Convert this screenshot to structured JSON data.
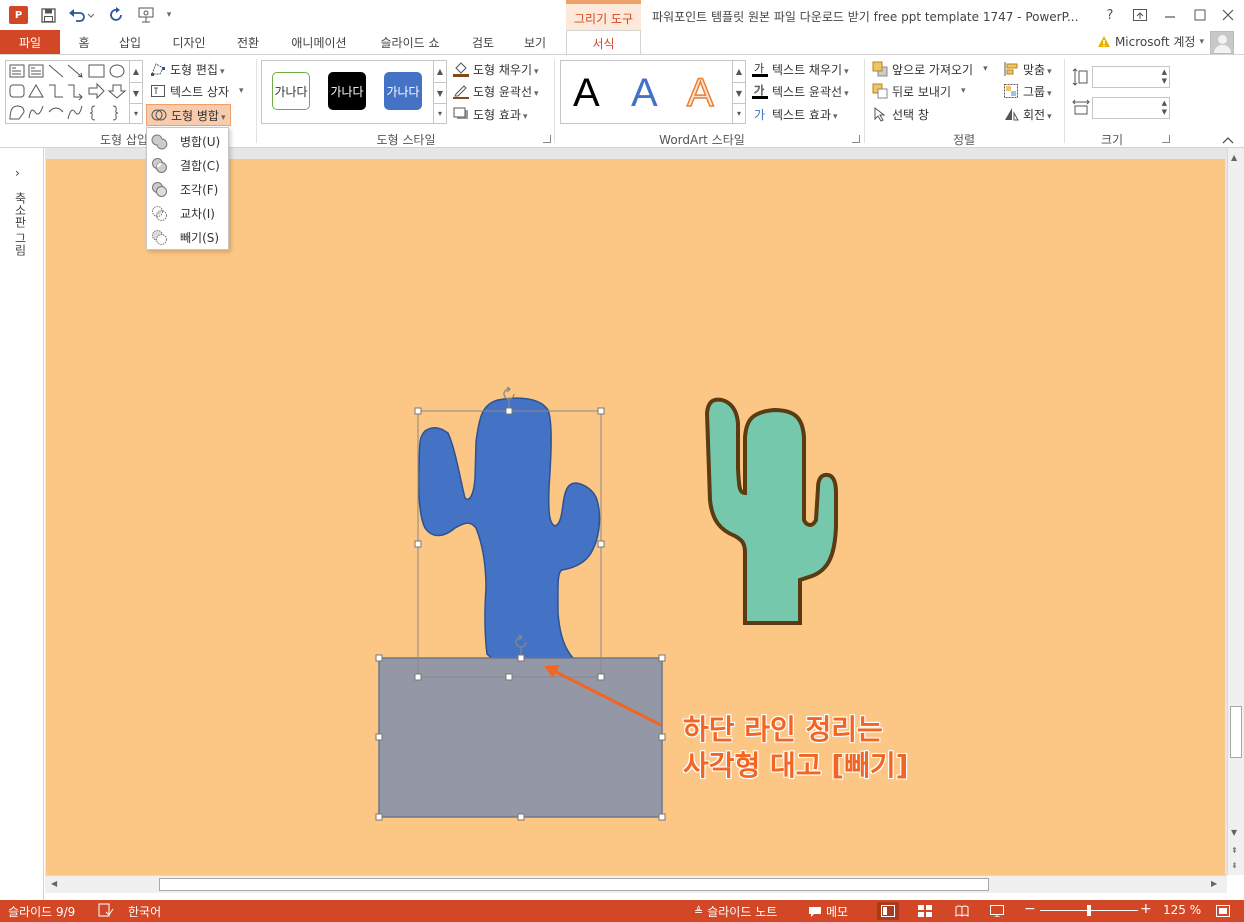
{
  "window": {
    "title": "파워포인트 템플릿 원본 파일 다운로드 받기 free ppt template 1747 - PowerP...",
    "context_tab": "그리기 도구",
    "help": "?"
  },
  "tabs": [
    {
      "label": "파일"
    },
    {
      "label": "홈"
    },
    {
      "label": "삽입"
    },
    {
      "label": "디자인"
    },
    {
      "label": "전환"
    },
    {
      "label": "애니메이션"
    },
    {
      "label": "슬라이드 쇼"
    },
    {
      "label": "검토"
    },
    {
      "label": "보기"
    },
    {
      "label": "서식"
    }
  ],
  "account": {
    "label": "Microsoft 계정",
    "warning_icon": "warning-icon"
  },
  "ribbon": {
    "insert_shapes": {
      "label": "도형 삽입",
      "edit_shape": "도형 편집",
      "text_box": "텍스트 상자",
      "merge_shapes": "도형 병합"
    },
    "shape_styles": {
      "label": "도형 스타일",
      "swatch_text": "가나다",
      "fill": "도형 채우기",
      "outline": "도형 윤곽선",
      "effects": "도형 효과"
    },
    "wordart": {
      "label": "WordArt 스타일",
      "letter": "A",
      "text_fill": "텍스트 채우기",
      "text_outline": "텍스트 윤곽선",
      "text_effects": "텍스트 효과"
    },
    "arrange": {
      "label": "정렬",
      "bring_forward": "앞으로 가져오기",
      "send_backward": "뒤로 보내기",
      "selection_pane": "선택 창",
      "align": "맞춤",
      "group": "그룹",
      "rotate": "회전"
    },
    "size": {
      "label": "크기",
      "height": "",
      "width": ""
    }
  },
  "merge_menu": [
    {
      "label": "병합(U)"
    },
    {
      "label": "결합(C)"
    },
    {
      "label": "조각(F)"
    },
    {
      "label": "교차(I)"
    },
    {
      "label": "빼기(S)"
    }
  ],
  "left_panel": {
    "label": "축소판 그림"
  },
  "slide": {
    "background": "#fcc685",
    "annotation_line1": "하단 라인 정리는",
    "annotation_line2": "사각형 대고 [빼기]",
    "annotation_color": "#f26522",
    "blue_cactus_fill": "#4472c4",
    "green_cactus_fill": "#76c8ad",
    "rectangle_fill": "#9497a6"
  },
  "status": {
    "slide_counter": "슬라이드 9/9",
    "language": "한국어",
    "notes": "슬라이드 노트",
    "comments": "메모",
    "zoom": "125 %",
    "accent": "#d24726"
  }
}
